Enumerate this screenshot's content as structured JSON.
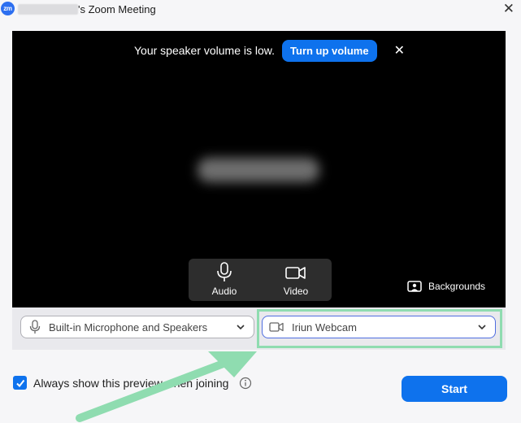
{
  "window": {
    "logo_text": "zm",
    "title": "'s Zoom Meeting",
    "close_glyph": "✕"
  },
  "banner": {
    "message": "Your speaker volume is low.",
    "action_label": "Turn up volume",
    "dismiss_glyph": "✕"
  },
  "controls": {
    "audio_label": "Audio",
    "video_label": "Video",
    "backgrounds_label": "Backgrounds"
  },
  "devices": {
    "audio_selected": "Built-in Microphone and Speakers",
    "video_selected": "Iriun Webcam"
  },
  "preview": {
    "checkbox_label": "Always show this preview when joining",
    "checked": true
  },
  "start_label": "Start",
  "colors": {
    "accent": "#0e72ed",
    "highlight": "#8fdcb0",
    "arrow": "#8fdcb0"
  },
  "icons": [
    "zoom-logo-icon",
    "close-icon",
    "microphone-icon",
    "video-camera-icon",
    "backgrounds-icon",
    "chevron-down-icon",
    "checkmark-icon",
    "info-icon"
  ]
}
